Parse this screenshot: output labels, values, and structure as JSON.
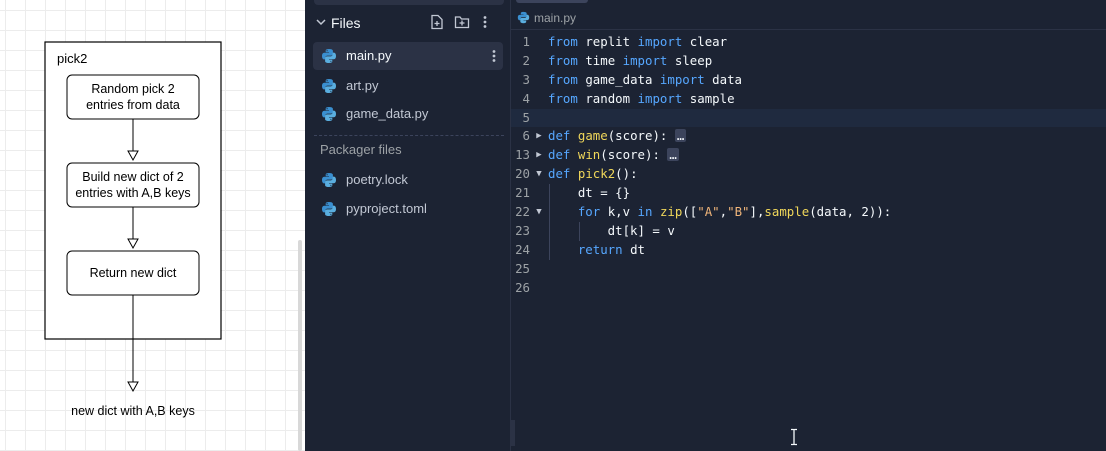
{
  "diagram": {
    "container_label": "pick2",
    "steps": [
      "Random pick 2",
      "entries from data",
      "Build new dict of 2",
      "entries with A,B keys",
      "Return new dict"
    ],
    "output_label": "new dict with A,B keys"
  },
  "files": {
    "title": "Files",
    "items": [
      {
        "name": "main.py",
        "active": true
      },
      {
        "name": "art.py",
        "active": false
      },
      {
        "name": "game_data.py",
        "active": false
      }
    ],
    "packager_title": "Packager files",
    "packager_items": [
      {
        "name": "poetry.lock"
      },
      {
        "name": "pyproject.toml"
      }
    ]
  },
  "editor": {
    "breadcrumb": "main.py",
    "lines": [
      {
        "n": "1",
        "fold": "",
        "code": [
          [
            "kw",
            "from"
          ],
          [
            "",
            "replit"
          ],
          [
            "kw",
            "import"
          ],
          [
            "",
            "clear"
          ]
        ]
      },
      {
        "n": "2",
        "fold": "",
        "code": [
          [
            "kw",
            "from"
          ],
          [
            "",
            "time"
          ],
          [
            "kw",
            "import"
          ],
          [
            "",
            "sleep"
          ]
        ]
      },
      {
        "n": "3",
        "fold": "",
        "code": [
          [
            "kw",
            "from"
          ],
          [
            "",
            "game_data"
          ],
          [
            "kw",
            "import"
          ],
          [
            "",
            "data"
          ]
        ]
      },
      {
        "n": "4",
        "fold": "",
        "code": [
          [
            "kw",
            "from"
          ],
          [
            "",
            "random"
          ],
          [
            "kw",
            "import"
          ],
          [
            "",
            "sample"
          ]
        ]
      },
      {
        "n": "5",
        "fold": "",
        "code": []
      },
      {
        "n": "6",
        "fold": "▶",
        "code": [
          [
            "kw",
            "def"
          ],
          [
            "fn",
            "game"
          ],
          [
            "",
            "(score):"
          ],
          [
            "el",
            "…"
          ]
        ]
      },
      {
        "n": "13",
        "fold": "▶",
        "code": [
          [
            "kw",
            "def"
          ],
          [
            "fn",
            "win"
          ],
          [
            "",
            "(score):"
          ],
          [
            "el",
            "…"
          ]
        ]
      },
      {
        "n": "20",
        "fold": "▼",
        "code": [
          [
            "kw",
            "def"
          ],
          [
            "fn",
            "pick2"
          ],
          [
            "",
            "():"
          ]
        ]
      },
      {
        "n": "21",
        "fold": "",
        "code": [
          [
            "",
            "    dt = {}"
          ]
        ]
      },
      {
        "n": "22",
        "fold": "▼",
        "code": [
          [
            "kw",
            "    for"
          ],
          [
            "",
            "k,v"
          ],
          [
            "kw",
            "in"
          ],
          [
            "fn",
            "zip"
          ],
          [
            "",
            "(["
          ],
          [
            "str",
            "\"A\""
          ],
          [
            "",
            ","
          ],
          [
            "str",
            "\"B\""
          ],
          [
            "",
            "],"
          ],
          [
            "fn",
            "sample"
          ],
          [
            "",
            "(data, 2)):"
          ]
        ]
      },
      {
        "n": "23",
        "fold": "",
        "code": [
          [
            "",
            "        dt[k] = v"
          ]
        ]
      },
      {
        "n": "24",
        "fold": "",
        "code": [
          [
            "kw",
            "    return"
          ],
          [
            "",
            "dt"
          ]
        ]
      },
      {
        "n": "25",
        "fold": "",
        "code": []
      },
      {
        "n": "26",
        "fold": "",
        "code": []
      }
    ]
  }
}
